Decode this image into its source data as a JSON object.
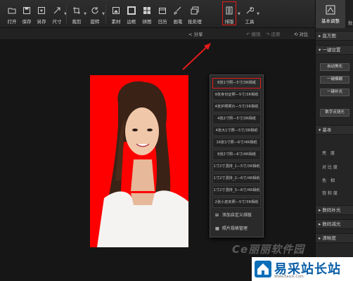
{
  "toolbar": {
    "items": [
      {
        "label": "打开",
        "icon": "folder-icon"
      },
      {
        "label": "保存",
        "icon": "save-icon"
      },
      {
        "label": "另存",
        "icon": "save-as-icon"
      },
      {
        "label": "尺寸",
        "icon": "resize-icon"
      },
      {
        "label": "裁剪",
        "icon": "crop-icon"
      },
      {
        "label": "旋转",
        "icon": "rotate-icon"
      },
      {
        "label": "素材",
        "icon": "material-icon"
      },
      {
        "label": "边框",
        "icon": "border-icon"
      },
      {
        "label": "拼图",
        "icon": "collage-icon"
      },
      {
        "label": "日历",
        "icon": "calendar-icon"
      },
      {
        "label": "画笔",
        "icon": "brush-icon"
      },
      {
        "label": "批处理",
        "icon": "batch-icon"
      },
      {
        "label": "排版",
        "icon": "layout-icon"
      },
      {
        "label": "工具",
        "icon": "tools-icon"
      }
    ]
  },
  "subbar": {
    "share": "分享",
    "compare": "对比",
    "undo": "撤销",
    "redo": "还原"
  },
  "layout_menu": {
    "items": [
      "8张1寸照—5寸/3R相纸",
      "9张身份证照—5寸/3R相纸",
      "4张护照照片—5寸/3R相纸",
      "4张2寸照—5寸/3R相纸",
      "4张大1寸照—5寸/3R相纸",
      "16张1寸照—6寸/4R相纸",
      "8张2寸照—6寸/4R相纸",
      "1寸2寸混排_1—5寸/3R相纸",
      "1寸2寸混排_2—6寸/4R相纸",
      "1寸2寸混排_3—6寸/4R相纸",
      "2张小皮夹照—5寸/3R相纸"
    ],
    "selected_index": 0,
    "add_custom": "添加自定义排版",
    "manage": "照片规格管理"
  },
  "right_panel": {
    "tab_active": "基本调整",
    "tab_other": "数",
    "histogram": "直方图",
    "one_click": "一键设置",
    "buttons": [
      "自动美化",
      "一键模糊",
      "一键补光"
    ],
    "digital_fill": "数字点测光",
    "basic": "基本",
    "sliders": [
      "亮　度",
      "对 比 度",
      "色　相",
      "饱 和 度"
    ],
    "digital_light": "数码补光",
    "digital_reduce": "数码减光",
    "sharpness": "清晰度"
  },
  "watermark": {
    "text": "Ce丽丽软件园",
    "site": "易采站长站",
    "url": "Www.Easck.Com"
  },
  "colors": {
    "accent": "#e21b1b",
    "photo_bg": "#ff0000",
    "brand": "#0a6fb8"
  }
}
